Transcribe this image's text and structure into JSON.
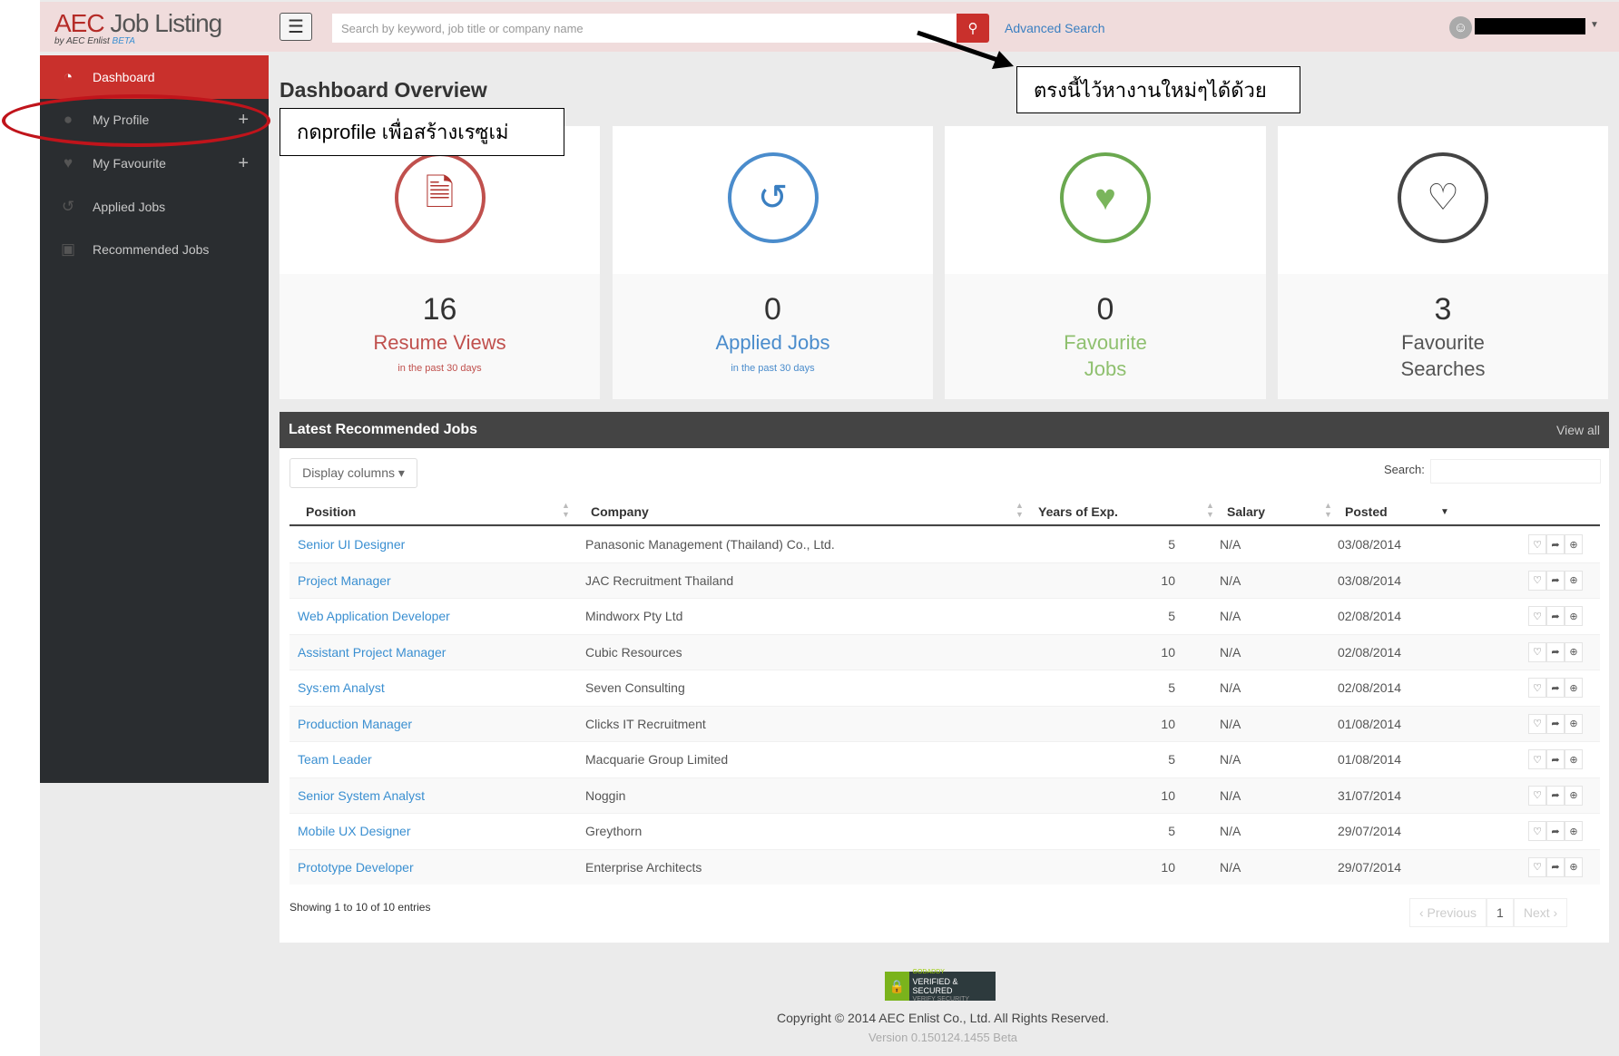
{
  "header": {
    "logo_main": "AEC",
    "logo_rest": " Job Listing",
    "logo_by": "by AEC Enlist",
    "logo_beta": "BETA",
    "search_placeholder": "Search by keyword, job title or company name",
    "advanced_search": "Advanced Search"
  },
  "sidebar": {
    "items": [
      {
        "label": "Dashboard",
        "icon": "dashboard-icon",
        "active": true
      },
      {
        "label": "My Profile",
        "icon": "user-icon",
        "expandable": true
      },
      {
        "label": "My Favourite",
        "icon": "heart-icon",
        "expandable": true
      },
      {
        "label": "Applied Jobs",
        "icon": "history-icon"
      },
      {
        "label": "Recommended Jobs",
        "icon": "briefcase-icon"
      }
    ]
  },
  "main": {
    "title": "Dashboard Overview",
    "annotations": {
      "profile_note": "กดprofile เพื่อสร้างเรซูเม่",
      "search_note": "ตรงนี้ไว้หางานใหม่ๆได้ด้วย"
    },
    "stats": [
      {
        "value": "16",
        "label": "Resume Views",
        "sub": "in the past 30 days",
        "color": "#c0504d",
        "icon": "document-icon"
      },
      {
        "value": "0",
        "label": "Applied Jobs",
        "sub": "in the past 30 days",
        "color": "#4a8ccc",
        "icon": "history-icon"
      },
      {
        "value": "0",
        "label": "Favourite Jobs",
        "sub": "",
        "color": "#6aa84f",
        "icon": "heart-filled-icon"
      },
      {
        "value": "3",
        "label": "Favourite Searches",
        "sub": "",
        "color": "#444444",
        "icon": "heart-outline-icon"
      }
    ],
    "jobs_panel": {
      "title": "Latest Recommended Jobs",
      "view_all": "View all",
      "display_columns": "Display columns ▾",
      "search_label": "Search:",
      "columns": [
        "Position",
        "Company",
        "Years of Exp.",
        "Salary",
        "Posted"
      ],
      "rows": [
        [
          "Senior UI Designer",
          "Panasonic Management (Thailand) Co., Ltd.",
          "5",
          "N/A",
          "03/08/2014"
        ],
        [
          "Project Manager",
          "JAC Recruitment Thailand",
          "10",
          "N/A",
          "03/08/2014"
        ],
        [
          "Web Application Developer",
          "Mindworx Pty Ltd",
          "5",
          "N/A",
          "02/08/2014"
        ],
        [
          "Assistant Project Manager",
          "Cubic Resources",
          "10",
          "N/A",
          "02/08/2014"
        ],
        [
          "Sys:em Analyst",
          "Seven Consulting",
          "5",
          "N/A",
          "02/08/2014"
        ],
        [
          "Production Manager",
          "Clicks IT Recruitment",
          "10",
          "N/A",
          "01/08/2014"
        ],
        [
          "Team Leader",
          "Macquarie Group Limited",
          "5",
          "N/A",
          "01/08/2014"
        ],
        [
          "Senior System Analyst",
          "Noggin",
          "10",
          "N/A",
          "31/07/2014"
        ],
        [
          "Mobile UX Designer",
          "Greythorn",
          "5",
          "N/A",
          "29/07/2014"
        ],
        [
          "Prototype Developer",
          "Enterprise Architects",
          "10",
          "N/A",
          "29/07/2014"
        ]
      ],
      "showing": "Showing 1 to 10 of 10 entries",
      "pager": {
        "prev": "‹ Previous",
        "page": "1",
        "next": "Next ›"
      }
    }
  },
  "footer": {
    "badge_top": "GODADDY",
    "badge_main": "VERIFIED & SECURED",
    "badge_sub": "VERIFY SECURITY",
    "copyright": "Copyright © 2014 AEC Enlist Co., Ltd. All Rights Reserved.",
    "version": "Version 0.150124.1455 Beta"
  }
}
